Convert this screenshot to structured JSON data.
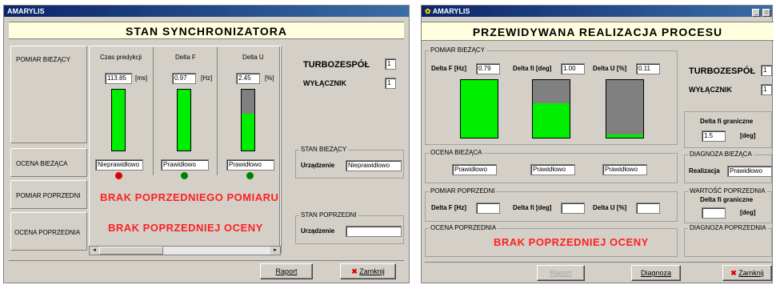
{
  "left": {
    "app_title": "AMARYLIS",
    "header": "STAN  SYNCHRONIZATORA",
    "side": {
      "pomiar_biezacy": "POMIAR BIEŻĄCY",
      "ocena_biezaca": "OCENA BIEŻĄCA",
      "pomiar_poprzedni": "POMIAR POPRZEDNI",
      "ocena_poprzednia": "OCENA POPRZEDNIA"
    },
    "columns": [
      {
        "label": "Czas predykcji",
        "value": "113.85",
        "unit": "[ms]",
        "fill": 1.0,
        "status": "Nieprawidłowo",
        "led": "#e00000"
      },
      {
        "label": "Delta F",
        "value": "0.97",
        "unit": "[Hz]",
        "fill": 1.0,
        "status": "Prawidłowo",
        "led": "#008000"
      },
      {
        "label": "Delta U",
        "value": "2.45",
        "unit": "[%]",
        "fill": 0.6,
        "status": "Prawidłowo",
        "led": "#008000"
      }
    ],
    "brak_pomiaru": "BRAK  POPRZEDNIEGO  POMIARU",
    "brak_oceny": "BRAK  POPRZEDNIEJ  OCENY",
    "turbozespol_label": "TURBOZESPÓŁ",
    "turbozespol_value": "1",
    "wylacznik_label": "WYŁĄCZNIK",
    "wylacznik_value": "1",
    "stan_biezacy": {
      "title": "STAN  BIEŻĄCY",
      "label": "Urządzenie",
      "value": "Nieprawidłowo"
    },
    "stan_poprzedni": {
      "title": "STAN  POPRZEDNI",
      "label": "Urządzenie",
      "value": ""
    },
    "raport": "Raport",
    "zamknij": "Zamknij"
  },
  "right": {
    "app_title": "AMARYLIS",
    "header": "PRZEWIDYWANA  REALIZACJA  PROCESU",
    "pomiar_biezacy": {
      "title": "POMIAR  BIEŻĄCY",
      "items": [
        {
          "label": "Delta F [Hz]",
          "value": "0.79",
          "fill": 1.0
        },
        {
          "label": "Delta fi [deg]",
          "value": "1.00",
          "fill": 0.6
        },
        {
          "label": "Delta U [%]",
          "value": "0.11",
          "fill": 0.05
        }
      ]
    },
    "ocena_biezaca": {
      "title": "OCENA  BIEŻĄCA",
      "values": [
        "Prawidłowo",
        "Prawidłowo",
        "Prawidłowo"
      ]
    },
    "pomiar_poprzedni": {
      "title": "POMIAR  POPRZEDNI",
      "labels": [
        "Delta F [Hz]",
        "Delta fi [deg]",
        "Delta U [%]"
      ]
    },
    "ocena_poprzednia": {
      "title": "OCENA  POPRZEDNIA",
      "message": "BRAK  POPRZEDNIEJ  OCENY"
    },
    "turbozespol_label": "TURBOZESPÓŁ",
    "turbozespol_value": "1",
    "wylacznik_label": "WYŁĄCZNIK",
    "wylacznik_value": "1",
    "delta_fi_graniczne": {
      "label": "Delta  fi  graniczne",
      "value": "1.5",
      "unit": "[deg]"
    },
    "diagnoza_biezaca": {
      "title": "DIAGNOZA  BIEŻĄCA",
      "label": "Realizacja",
      "value": "Prawidłowo"
    },
    "wartosc_poprzednia": {
      "title": "WARTOŚĆ  POPRZEDNIA",
      "label": "Delta  fi  graniczne",
      "unit": "[deg]"
    },
    "diagnoza_poprzednia": {
      "title": "DIAGNOZA  POPRZEDNIA"
    },
    "raport": "Raport",
    "diagnoza": "Diagnoza",
    "zamknij": "Zamknij"
  }
}
